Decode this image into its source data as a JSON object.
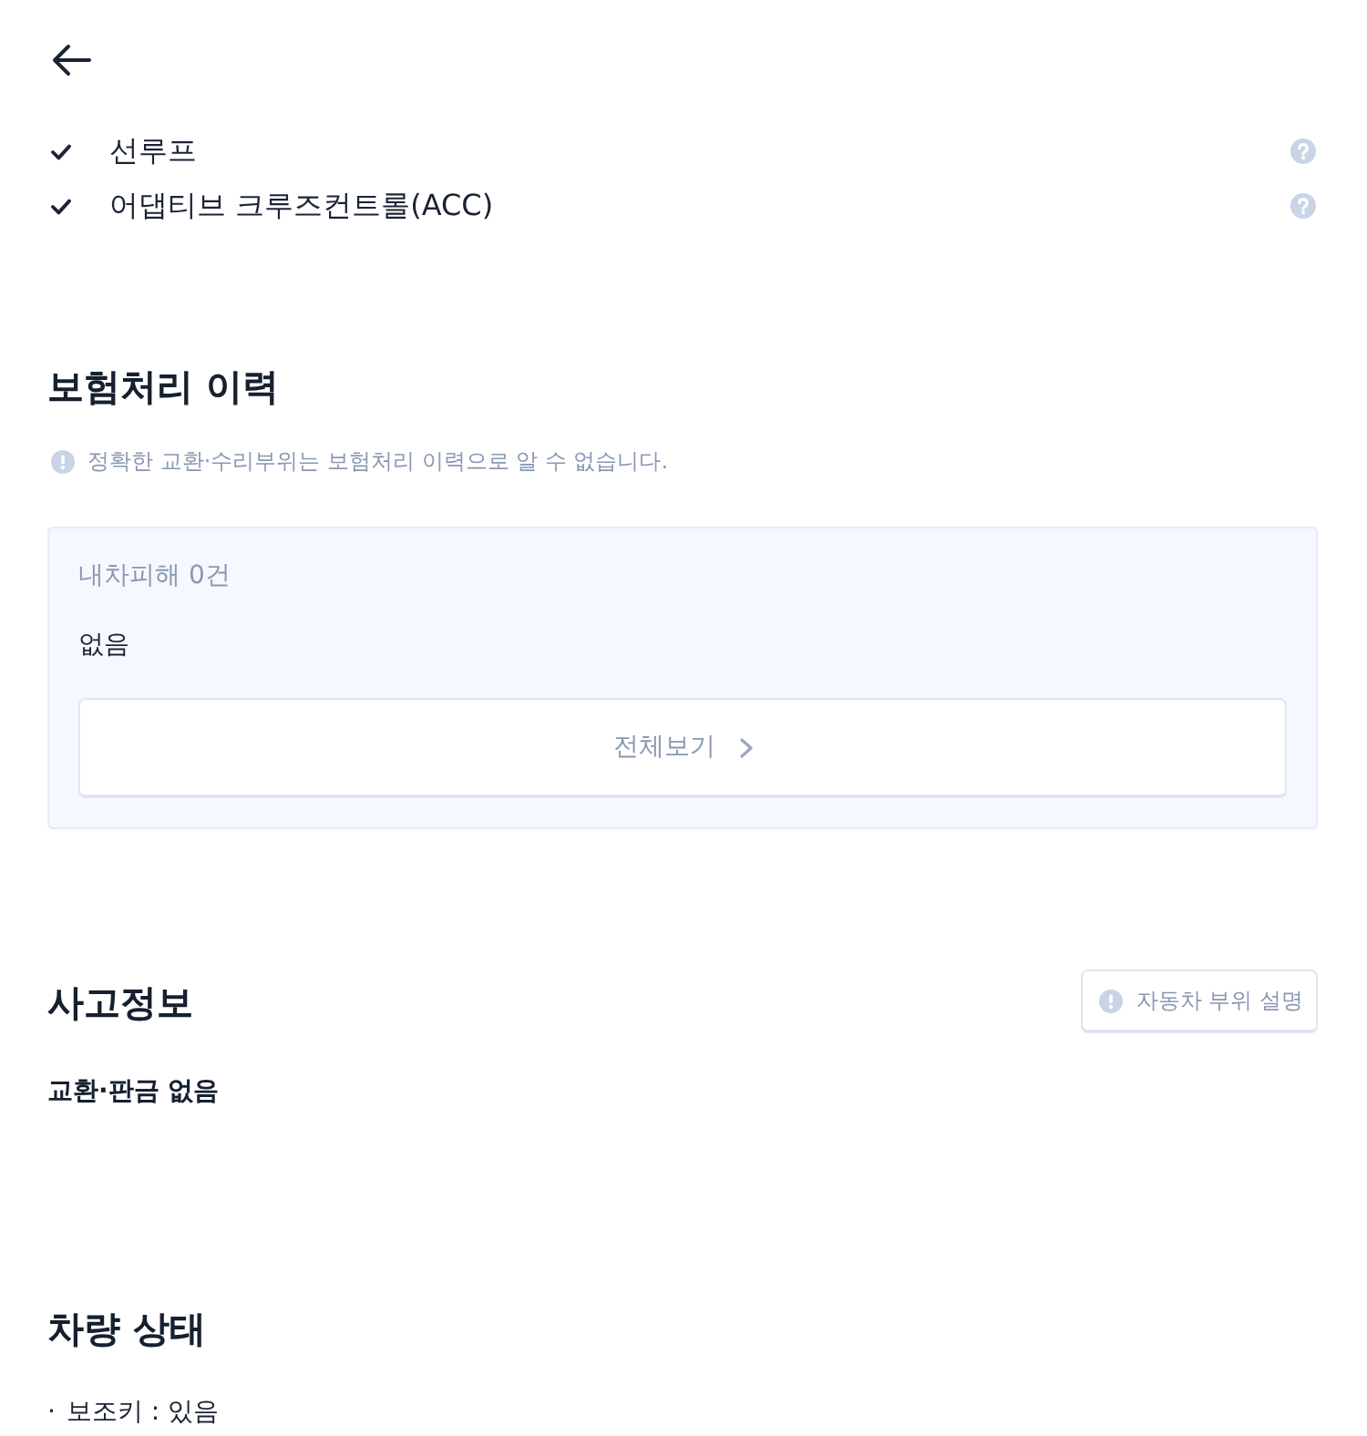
{
  "options": [
    {
      "label": "선루프",
      "checked": true
    },
    {
      "label": "어댑티브 크루즈컨트롤(ACC)",
      "checked": true
    }
  ],
  "insurance_history": {
    "title": "보험처리 이력",
    "notice": "정확한 교환·수리부위는 보험처리 이력으로 알 수 없습니다.",
    "summary": "내차피해 0건",
    "detail": "없음",
    "view_all_button": "전체보기"
  },
  "accident_info": {
    "title": "사고정보",
    "parts_button": "자동차 부위 설명",
    "summary": "교환·판금 없음"
  },
  "vehicle_condition": {
    "title": "차량 상태",
    "items": [
      {
        "marker": "·",
        "text": "보조키 : 있음"
      }
    ]
  }
}
